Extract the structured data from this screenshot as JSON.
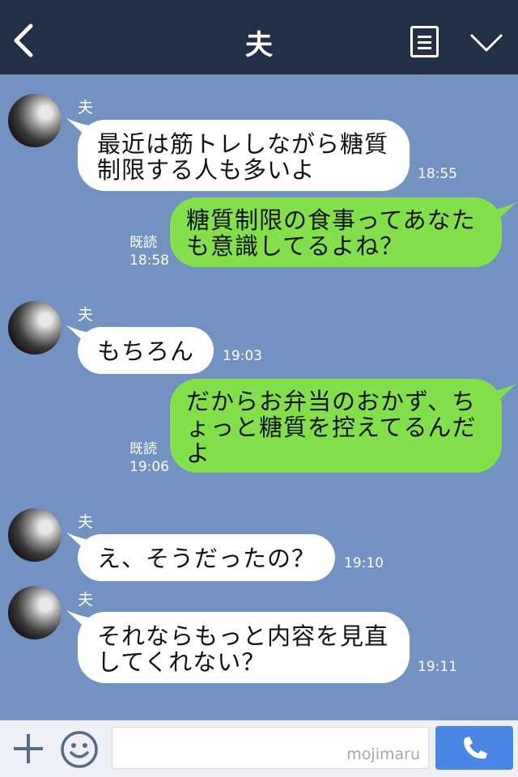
{
  "header": {
    "title": "夫"
  },
  "messages": [
    {
      "sender": "夫",
      "text_lines": [
        "最近は筋トレしながら糖質",
        "制限する人も多いよ"
      ],
      "time": "18:55"
    },
    {
      "text_lines": [
        "糖質制限の食事ってあなた",
        "も意識してるよね？"
      ],
      "read_label": "既読",
      "time": "18:58"
    },
    {
      "sender": "夫",
      "text_lines": [
        "もちろん"
      ],
      "time": "19:03"
    },
    {
      "text_lines": [
        "だからお弁当のおかず、ち",
        "ょっと糖質を控えてるんだ",
        "よ"
      ],
      "read_label": "既読",
      "time": "19:06"
    },
    {
      "sender": "夫",
      "text_lines": [
        "え、そうだったの？"
      ],
      "time": "19:10"
    },
    {
      "sender": "夫",
      "text_lines": [
        "それならもっと内容を見直",
        "してくれない？"
      ],
      "time": "19:11"
    }
  ],
  "footer": {
    "watermark": "mojimaru"
  },
  "colors": {
    "header_bg": "#232f46",
    "chat_bg": "#7292c1",
    "bubble_in": "#ffffff",
    "bubble_out": "#84e04a",
    "call_button": "#4a86e3"
  },
  "icons": {
    "back": "chevron-left-icon",
    "menu": "list-icon",
    "collapse": "chevron-down-icon",
    "plus": "plus-icon",
    "emoji": "smiley-icon",
    "call": "phone-icon"
  }
}
